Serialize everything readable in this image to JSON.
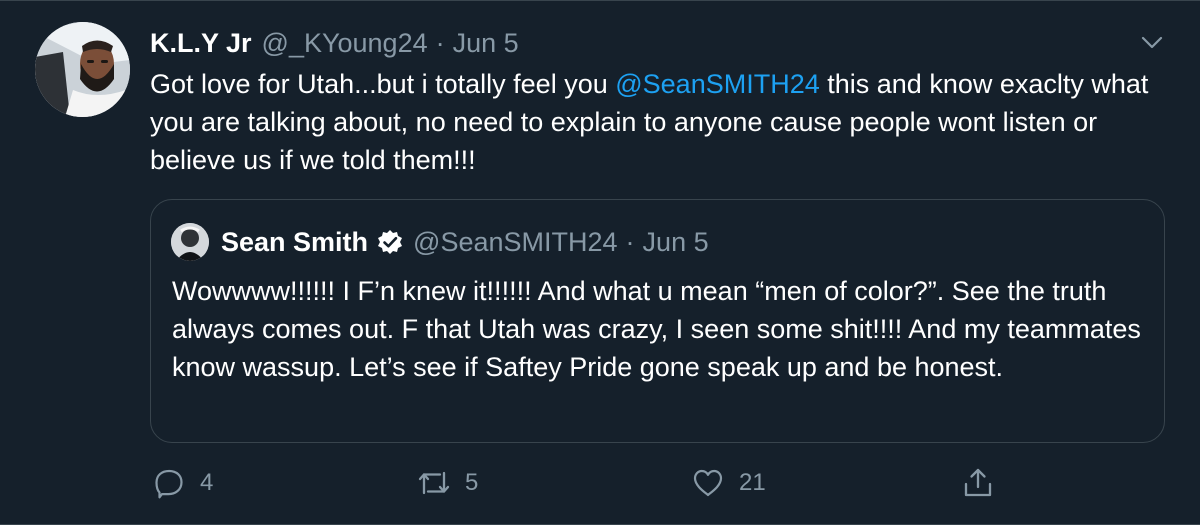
{
  "tweet": {
    "display_name": "K.L.Y Jr",
    "handle": "@_KYoung24",
    "separator": "·",
    "date": "Jun 5",
    "text_parts": {
      "before_mention": "Got love for Utah...but i totally feel you ",
      "mention": "@SeanSMITH24",
      "after_mention": " this and know exaclty what you are talking about, no need to explain to anyone cause people wont listen or believe us if we told them!!!"
    },
    "avatar_icon": "profile-photo-avatar",
    "menu_icon": "chevron-down-icon"
  },
  "quote": {
    "display_name": "Sean Smith",
    "verified_icon": "verified-badge-icon",
    "handle": "@SeanSMITH24",
    "separator": "·",
    "date": "Jun 5",
    "text": "Wowwww!!!!!! I F’n knew it!!!!!! And what u mean “men of color?”. See the truth always comes out. F that Utah was crazy, I seen some shit!!!! And my teammates know wassup. Let’s see if Saftey Pride gone speak up and be honest."
  },
  "actions": {
    "reply": {
      "icon": "reply-icon",
      "count": "4"
    },
    "retweet": {
      "icon": "retweet-icon",
      "count": "5"
    },
    "like": {
      "icon": "heart-icon",
      "count": "21"
    },
    "share": {
      "icon": "share-icon",
      "count": ""
    }
  },
  "colors": {
    "background": "#15202b",
    "text": "#ffffff",
    "muted": "#8899a6",
    "link": "#1da1f2",
    "border": "#38444d",
    "verified": "#ffffff"
  }
}
